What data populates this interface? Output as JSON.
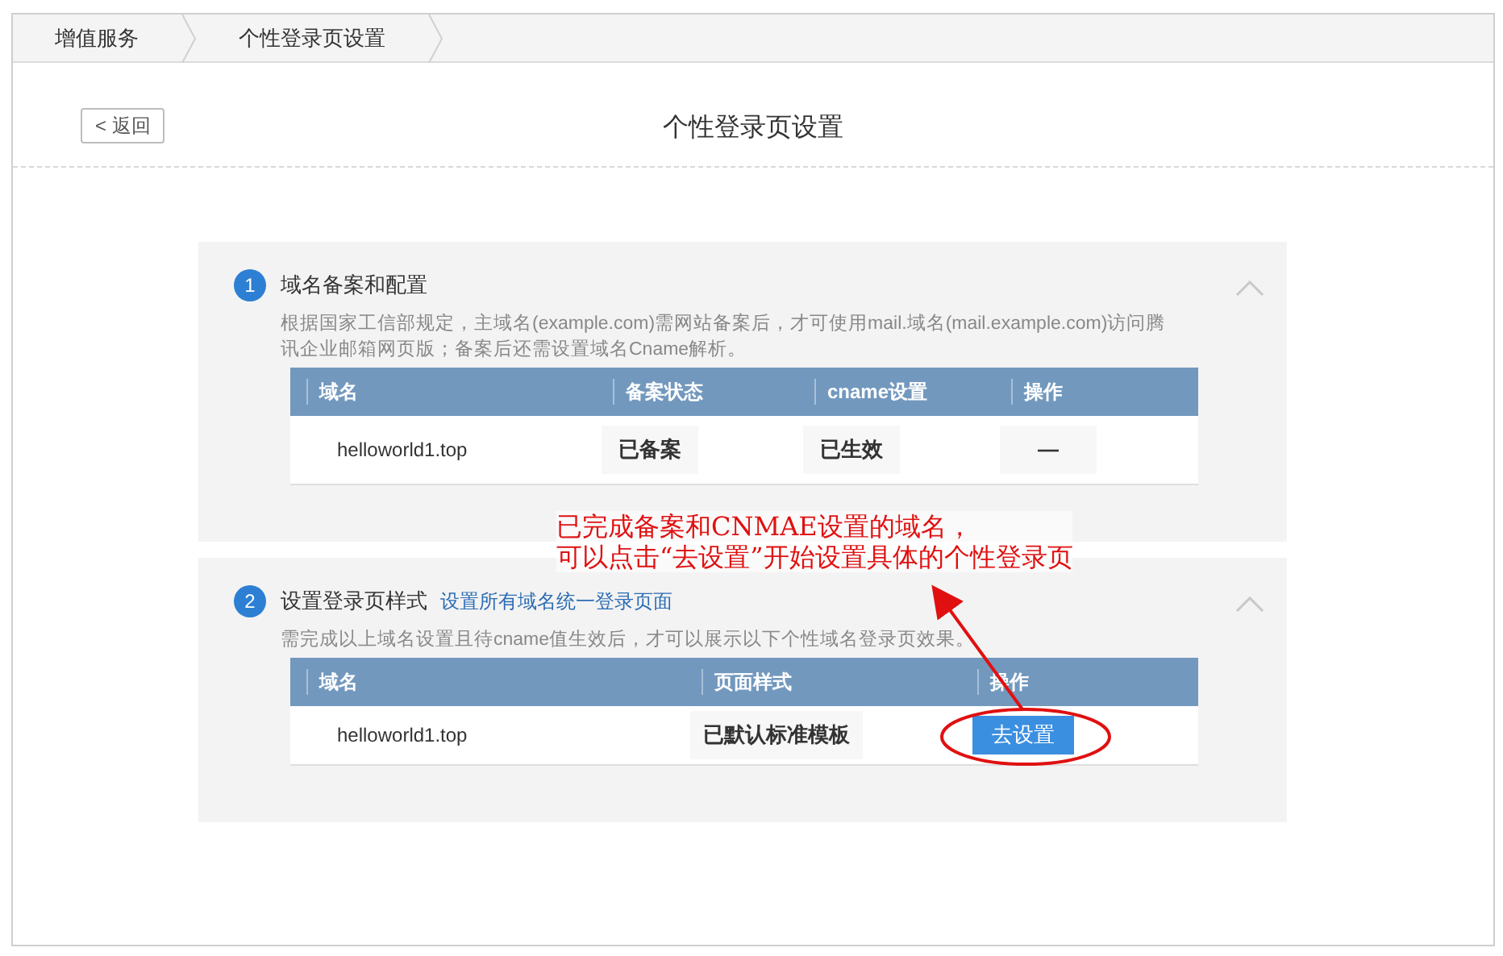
{
  "breadcrumb": [
    {
      "label": "增值服务"
    },
    {
      "label": "个性登录页设置"
    }
  ],
  "back_button": "< 返回",
  "page_title": "个性登录页设置",
  "sections": [
    {
      "number": "1",
      "title": "域名备案和配置",
      "expanded": true,
      "description": "根据国家工信部规定，主域名(example.com)需网站备案后，才可使用mail.域名(mail.example.com)访问腾讯企业邮箱网页版；备案后还需设置域名Cname解析。",
      "columns": [
        "域名",
        "备案状态",
        "cname设置",
        "操作"
      ],
      "rows": [
        {
          "cells": [
            {
              "kind": "text",
              "text": "helloworld1.top"
            },
            {
              "kind": "tag",
              "text": "已备案"
            },
            {
              "kind": "tag",
              "text": "已生效"
            },
            {
              "kind": "tag",
              "text": "—"
            }
          ]
        }
      ]
    },
    {
      "number": "2",
      "title": "设置登录页样式",
      "link": "设置所有域名统一登录页面",
      "expanded": true,
      "description": "需完成以上域名设置且待cname值生效后，才可以展示以下个性域名登录页效果。",
      "columns": [
        "域名",
        "页面样式",
        "操作"
      ],
      "rows": [
        {
          "cells": [
            {
              "kind": "text",
              "text": "helloworld1.top"
            },
            {
              "kind": "tag",
              "text": "已默认标准模板"
            },
            {
              "kind": "button",
              "text": "去设置"
            }
          ]
        }
      ]
    }
  ],
  "annotation": {
    "lines": [
      "已完成备案和CNMAE设置的域名，",
      "可以点击“去设置”开始设置具体的个性登录页"
    ]
  }
}
